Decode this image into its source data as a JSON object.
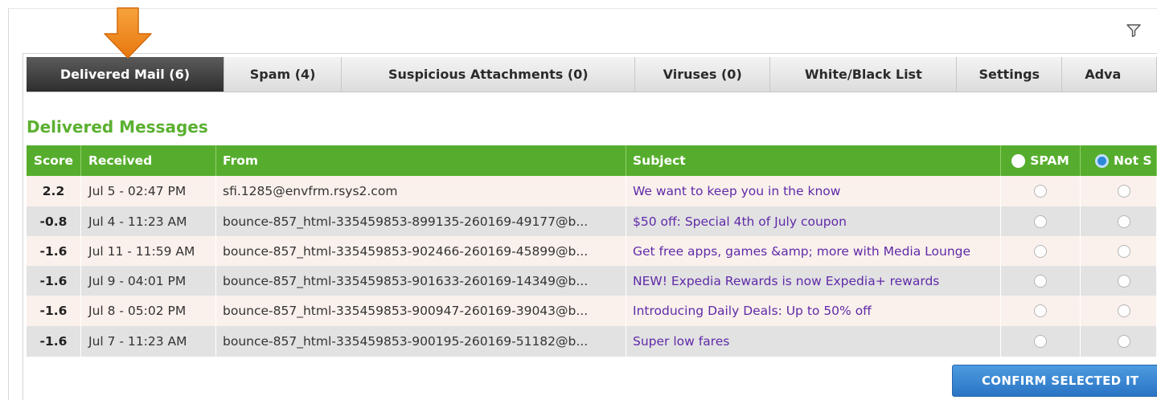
{
  "tabs": [
    {
      "label": "Delivered Mail (6)",
      "active": true
    },
    {
      "label": "Spam (4)",
      "active": false
    },
    {
      "label": "Suspicious Attachments (0)",
      "active": false
    },
    {
      "label": "Viruses (0)",
      "active": false
    },
    {
      "label": "White/Black List",
      "active": false
    },
    {
      "label": "Settings",
      "active": false
    },
    {
      "label": "Adva",
      "active": false
    }
  ],
  "section_title": "Delivered Messages",
  "table": {
    "headers": {
      "score": "Score",
      "received": "Received",
      "from": "From",
      "subject": "Subject",
      "spam": "SPAM",
      "not_spam": "Not S"
    },
    "rows": [
      {
        "score": "2.2",
        "received": "Jul 5 - 02:47 PM",
        "from": "sfi.1285@envfrm.rsys2.com",
        "subject": "We want to keep you in the know"
      },
      {
        "score": "-0.8",
        "received": "Jul 4 - 11:23 AM",
        "from": "bounce-857_html-335459853-899135-260169-49177@b...",
        "subject": "$50 off: Special 4th of July coupon"
      },
      {
        "score": "-1.6",
        "received": "Jul 11 - 11:59 AM",
        "from": "bounce-857_html-335459853-902466-260169-45899@b...",
        "subject": "Get free apps, games &amp; more with Media Lounge"
      },
      {
        "score": "-1.6",
        "received": "Jul 9 - 04:01 PM",
        "from": "bounce-857_html-335459853-901633-260169-14349@b...",
        "subject": "NEW! Expedia Rewards is now Expedia+ rewards"
      },
      {
        "score": "-1.6",
        "received": "Jul 8 - 05:02 PM",
        "from": "bounce-857_html-335459853-900947-260169-39043@b...",
        "subject": "Introducing Daily Deals: Up to 50% off"
      },
      {
        "score": "-1.6",
        "received": "Jul 7 - 11:23 AM",
        "from": "bounce-857_html-335459853-900195-260169-51182@b...",
        "subject": "Super low fares"
      }
    ]
  },
  "confirm_button": "CONFIRM SELECTED IT",
  "icons": {
    "filter": "filter-icon",
    "arrow": "down-arrow-icon",
    "arrow_color": "#f08a1c"
  },
  "colors": {
    "accent_green": "#56ad2d",
    "subject_link": "#5f2aa8",
    "button_blue": "#3a87d4"
  }
}
